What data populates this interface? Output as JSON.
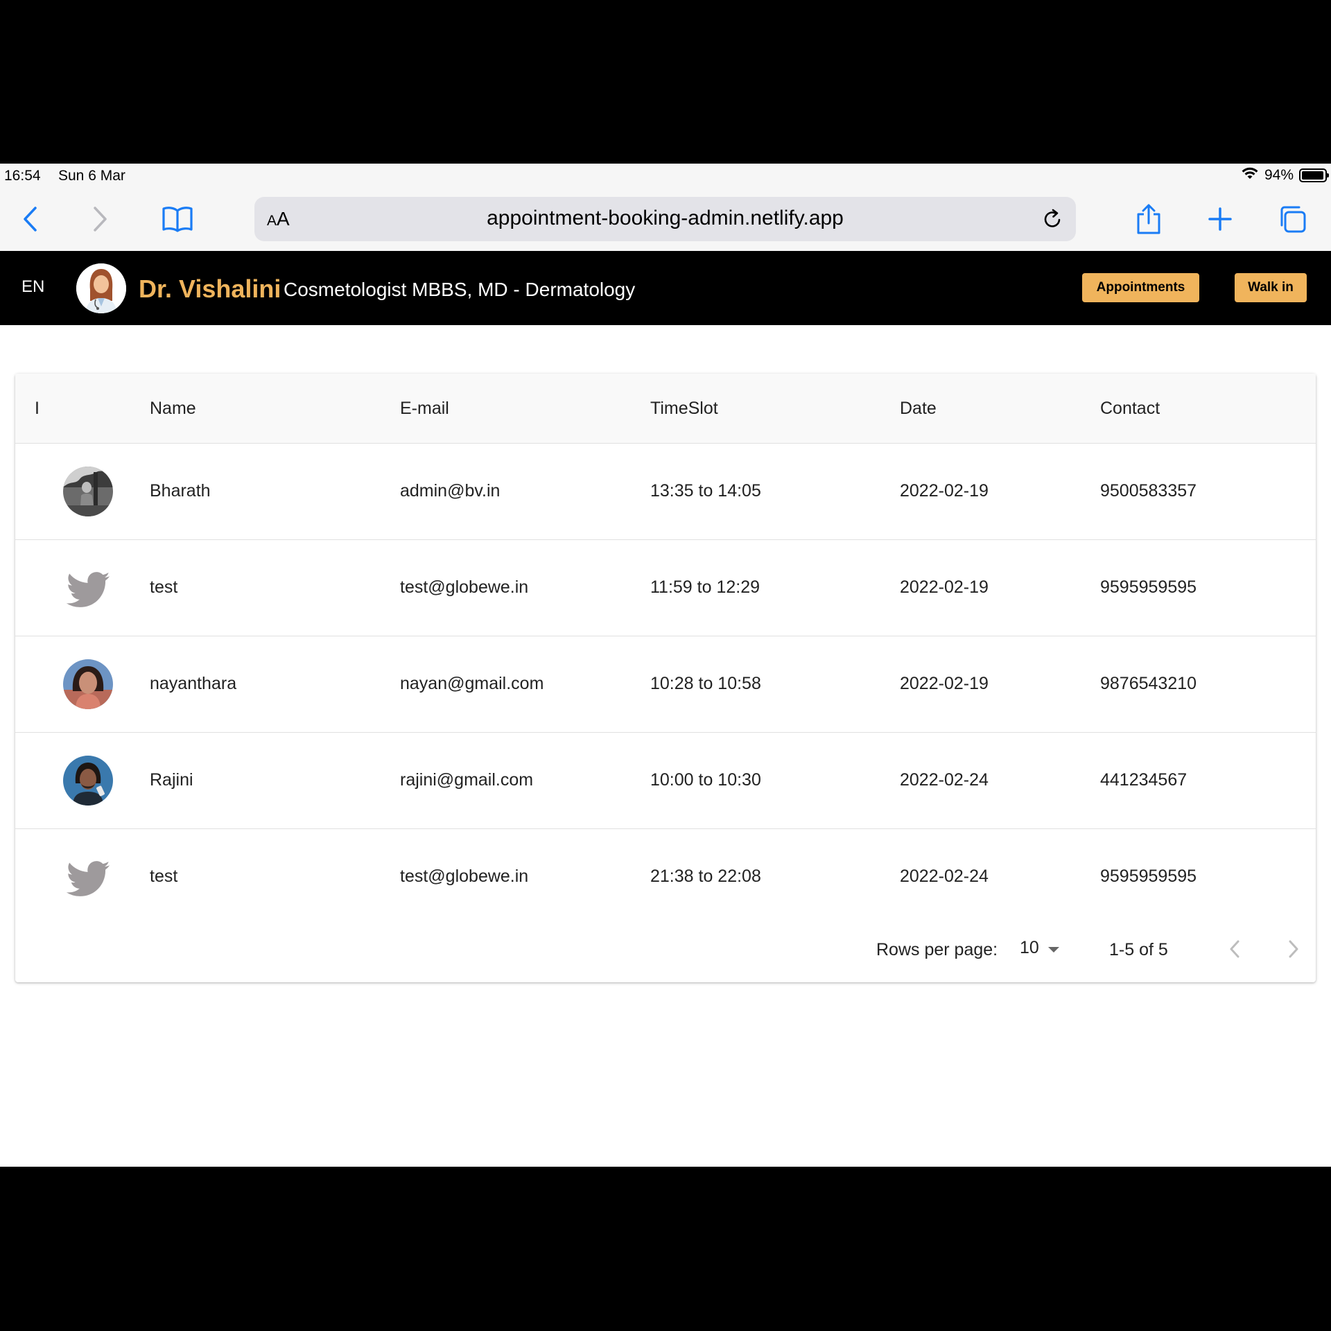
{
  "status_bar": {
    "time": "16:54",
    "date": "Sun 6 Mar",
    "battery": "94%"
  },
  "browser": {
    "aa_small": "A",
    "aa_large": "A",
    "url": "appointment-booking-admin.netlify.app",
    "accent_color": "#1a7cf5"
  },
  "header": {
    "language": "EN",
    "doctor_name": "Dr. Vishalini",
    "doctor_title": "Cosmetologist MBBS, MD - Dermatology",
    "appointments_label": "Appointments",
    "walkin_label": "Walk in",
    "accent_color": "#f0b45c"
  },
  "table": {
    "columns": [
      "I",
      "Name",
      "E-mail",
      "TimeSlot",
      "Date",
      "Contact"
    ],
    "rows": [
      {
        "avatar": "photo-avatar-grayscale",
        "name": "Bharath",
        "email": "admin@bv.in",
        "timeslot": "13:35 to 14:05",
        "date": "2022-02-19",
        "contact": "9500583357"
      },
      {
        "avatar": "twitter-bird-icon",
        "name": "test",
        "email": "test@globewe.in",
        "timeslot": "11:59 to 12:29",
        "date": "2022-02-19",
        "contact": "9595959595"
      },
      {
        "avatar": "photo-avatar-color",
        "name": "nayanthara",
        "email": "nayan@gmail.com",
        "timeslot": "10:28 to 10:58",
        "date": "2022-02-19",
        "contact": "9876543210"
      },
      {
        "avatar": "photo-avatar-color",
        "name": "Rajini",
        "email": "rajini@gmail.com",
        "timeslot": "10:00 to 10:30",
        "date": "2022-02-24",
        "contact": "441234567"
      },
      {
        "avatar": "twitter-bird-icon",
        "name": "test",
        "email": "test@globewe.in",
        "timeslot": "21:38 to 22:08",
        "date": "2022-02-24",
        "contact": "9595959595"
      }
    ]
  },
  "pagination": {
    "rows_per_page_label": "Rows per page:",
    "rows_per_page_value": "10",
    "range": "1-5 of 5"
  }
}
